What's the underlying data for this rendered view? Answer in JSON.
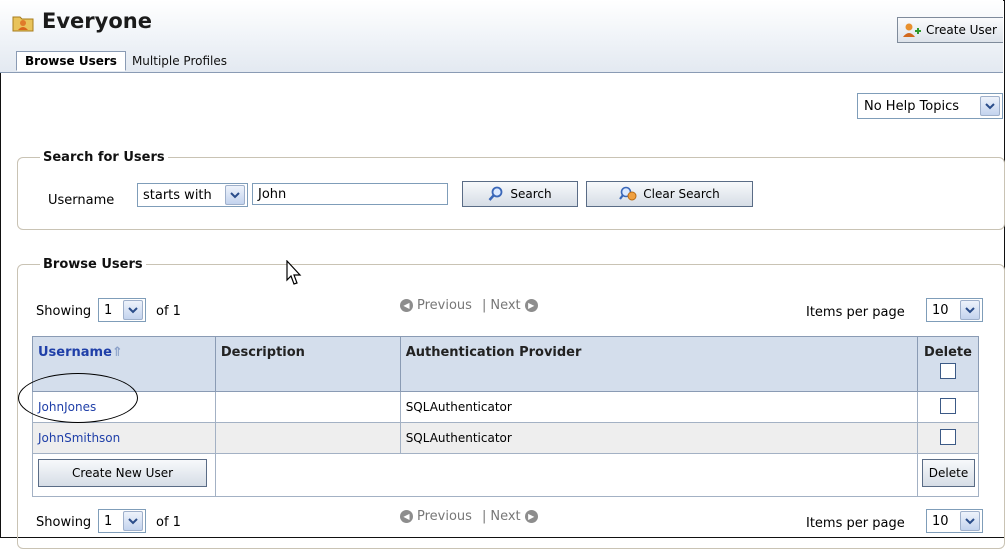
{
  "header": {
    "title": "Everyone",
    "create_user_label": "Create User"
  },
  "tabs": [
    {
      "label": "Browse Users"
    },
    {
      "label": "Multiple Profiles"
    }
  ],
  "help": {
    "selected": "No Help Topics"
  },
  "search": {
    "legend": "Search for Users",
    "field_label": "Username",
    "operator": "starts with",
    "value": "John",
    "search_button": "Search",
    "clear_button": "Clear Search"
  },
  "browse": {
    "legend": "Browse Users",
    "showing_label": "Showing",
    "page": "1",
    "of_label": "of 1",
    "previous": "Previous",
    "separator": "|",
    "next": "Next",
    "items_per_page_label": "Items per page",
    "items_per_page": "10",
    "columns": {
      "username": "Username",
      "description": "Description",
      "provider": "Authentication Provider",
      "delete": "Delete"
    },
    "rows": [
      {
        "username": "JohnJones",
        "description": "",
        "provider": "SQLAuthenticator"
      },
      {
        "username": "JohnSmithson",
        "description": "",
        "provider": "SQLAuthenticator"
      }
    ],
    "create_new_user_button": "Create New User",
    "delete_button": "Delete"
  },
  "colors": {
    "header_bg": "#eef2f7",
    "table_header_bg": "#d4deec",
    "link": "#1f3fa8"
  }
}
